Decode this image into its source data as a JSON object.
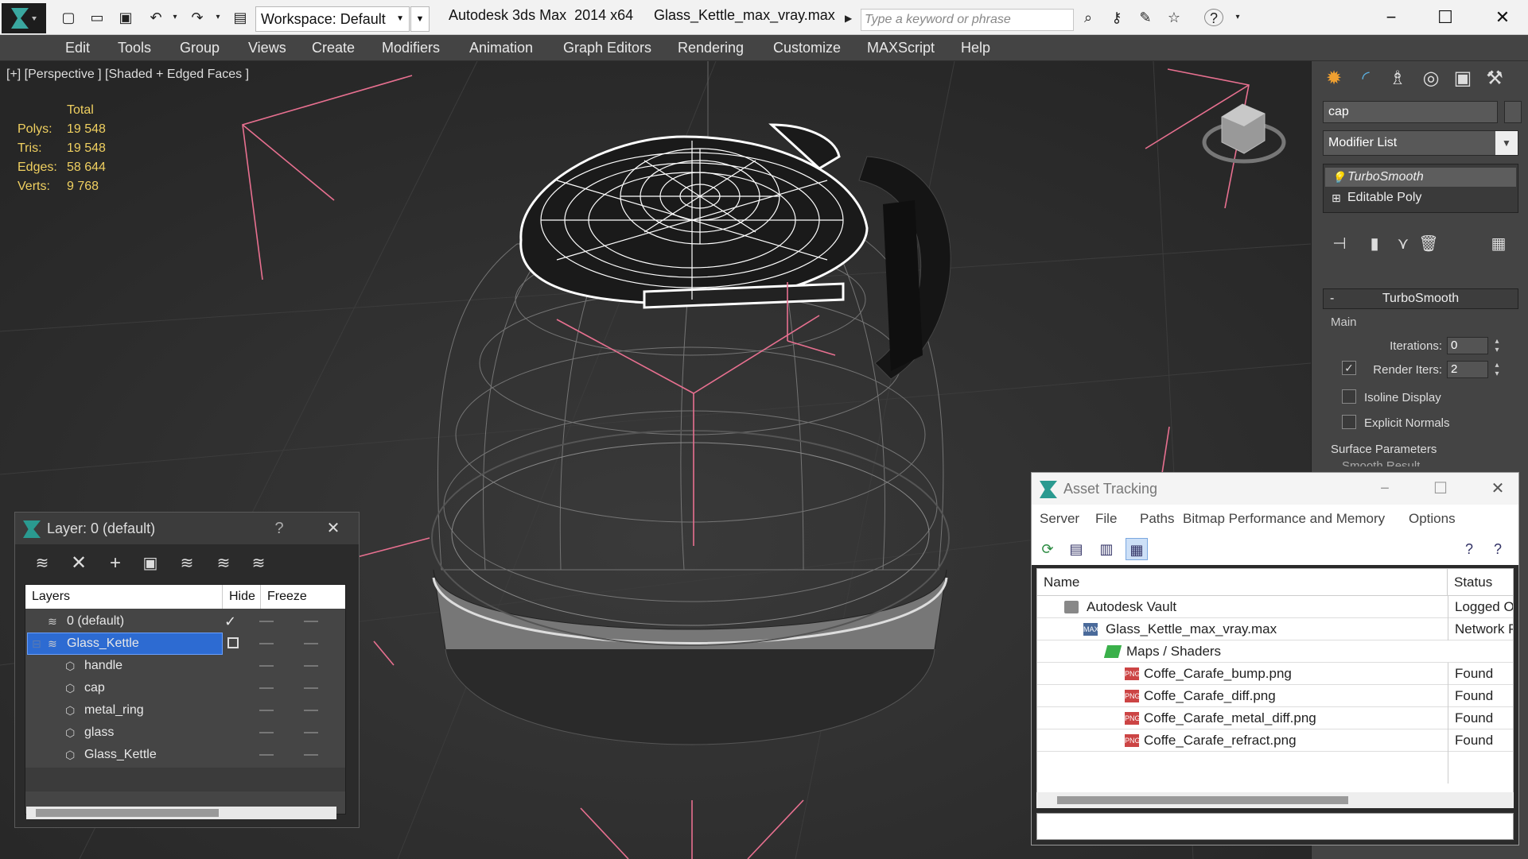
{
  "titlebar": {
    "workspace": "Workspace: Default",
    "app_title": "Autodesk 3ds Max  2014 x64",
    "file_title": "Glass_Kettle_max_vray.max",
    "search_placeholder": "Type a keyword or phrase"
  },
  "menu": [
    "Edit",
    "Tools",
    "Group",
    "Views",
    "Create",
    "Modifiers",
    "Animation",
    "Graph Editors",
    "Rendering",
    "Customize",
    "MAXScript",
    "Help"
  ],
  "viewport": {
    "label": "[+] [Perspective ] [Shaded + Edged Faces ]",
    "stats_header": "Total",
    "stats": [
      {
        "k": "Polys:",
        "v": "19 548"
      },
      {
        "k": "Tris:",
        "v": "19 548"
      },
      {
        "k": "Edges:",
        "v": "58 644"
      },
      {
        "k": "Verts:",
        "v": "9 768"
      }
    ]
  },
  "command_panel": {
    "object_name": "cap",
    "modifier_list": "Modifier List",
    "stack": [
      "TurboSmooth",
      "Editable Poly"
    ],
    "rollout_title": "TurboSmooth",
    "group_main": "Main",
    "iterations_label": "Iterations:",
    "iterations_value": "0",
    "render_iters_label": "Render Iters:",
    "render_iters_value": "2",
    "isoline": "Isoline Display",
    "explicit_normals": "Explicit Normals",
    "group_surface": "Surface Parameters",
    "smooth_result": "Smooth Result"
  },
  "layer_window": {
    "title": "Layer: 0 (default)",
    "help": "?",
    "col_layers": "Layers",
    "col_hide": "Hide",
    "col_freeze": "Freeze",
    "rows": [
      {
        "name": "0 (default)"
      },
      {
        "name": "Glass_Kettle"
      },
      {
        "name": "handle"
      },
      {
        "name": "cap"
      },
      {
        "name": "metal_ring"
      },
      {
        "name": "glass"
      },
      {
        "name": "Glass_Kettle"
      }
    ]
  },
  "asset_window": {
    "title": "Asset Tracking",
    "menu": [
      "Server",
      "File",
      "Paths",
      "Bitmap Performance and Memory",
      "Options"
    ],
    "col_name": "Name",
    "col_status": "Status",
    "rows": [
      {
        "name": "Autodesk Vault",
        "status": "Logged Out"
      },
      {
        "name": "Glass_Kettle_max_vray.max",
        "status": "Network Path"
      },
      {
        "name": "Maps / Shaders",
        "status": ""
      },
      {
        "name": "Coffe_Carafe_bump.png",
        "status": "Found"
      },
      {
        "name": "Coffe_Carafe_diff.png",
        "status": "Found"
      },
      {
        "name": "Coffe_Carafe_metal_diff.png",
        "status": "Found"
      },
      {
        "name": "Coffe_Carafe_refract.png",
        "status": "Found"
      }
    ],
    "png_tag": "PNG",
    "max_tag": "MAX"
  }
}
